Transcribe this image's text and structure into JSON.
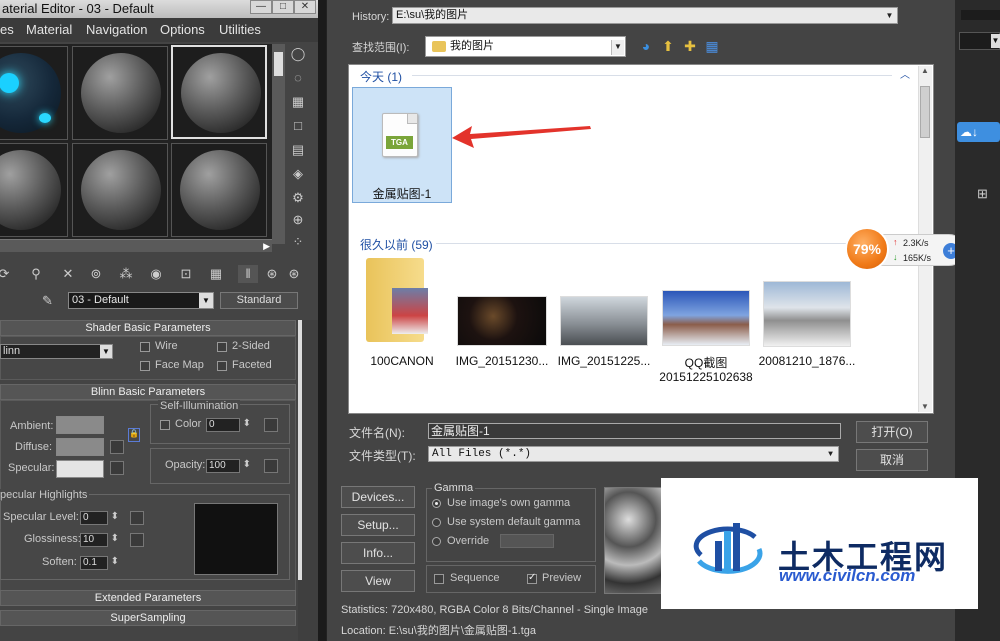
{
  "material_editor": {
    "title": "aterial Editor - 03 - Default",
    "menu": [
      "es",
      "Material",
      "Navigation",
      "Options",
      "Utilities"
    ],
    "material_name": "03 - Default",
    "material_type": "Standard",
    "shader_rollout": "Shader Basic Parameters",
    "shader_type": "linn",
    "wire": "Wire",
    "two_sided": "2-Sided",
    "face_map": "Face Map",
    "faceted": "Faceted",
    "blinn_rollout": "Blinn Basic Parameters",
    "self_illum": "Self-Illumination",
    "ambient": "Ambient:",
    "diffuse": "Diffuse:",
    "specular": "Specular:",
    "color_label": "Color",
    "color_value": "0",
    "opacity_label": "Opacity:",
    "opacity_value": "100",
    "highlights_title": "pecular Highlights",
    "spec_level_label": "Specular Level:",
    "spec_level": "0",
    "glossiness_label": "Glossiness:",
    "glossiness": "10",
    "soften_label": "Soften:",
    "soften": "0.1",
    "extended": "Extended Parameters",
    "supersampling": "SuperSampling"
  },
  "dialog": {
    "history_label": "History:",
    "history_value": "E:\\su\\我的图片",
    "lookin_label": "查找范围(I):",
    "lookin_value": "我的图片",
    "group_today": "今天 (1)",
    "group_old": "很久以前 (59)",
    "selected_file": "金属贴图-1",
    "tga_tag": "TGA",
    "files": [
      {
        "name": "100CANON"
      },
      {
        "name": "IMG_20151230..."
      },
      {
        "name": "IMG_20151225..."
      },
      {
        "name": "QQ截图",
        "name2": "20151225102638"
      },
      {
        "name": "20081210_1876..."
      }
    ],
    "filename_label": "文件名(N):",
    "filename_value": "金属贴图-1",
    "filetype_label": "文件类型(T):",
    "filetype_value": "All Files (*.*)",
    "open_btn": "打开(O)",
    "cancel_btn": "取消",
    "devices_btn": "Devices...",
    "setup_btn": "Setup...",
    "info_btn": "Info...",
    "view_btn": "View",
    "gamma_title": "Gamma",
    "gamma_opt1": "Use image's own gamma",
    "gamma_opt2": "Use system default gamma",
    "gamma_opt3": "Override",
    "sequence": "Sequence",
    "preview": "Preview",
    "statistics": "Statistics:  720x480, RGBA Color 8 Bits/Channel - Single Image",
    "location": "Location:  E:\\su\\我的图片\\金属贴图-1.tga"
  },
  "net_widget": {
    "percent": "79%",
    "up": "2.3K/s",
    "down": "165K/s"
  },
  "watermark": {
    "cn": "土木工程网",
    "url": "www.civilcn.com"
  }
}
